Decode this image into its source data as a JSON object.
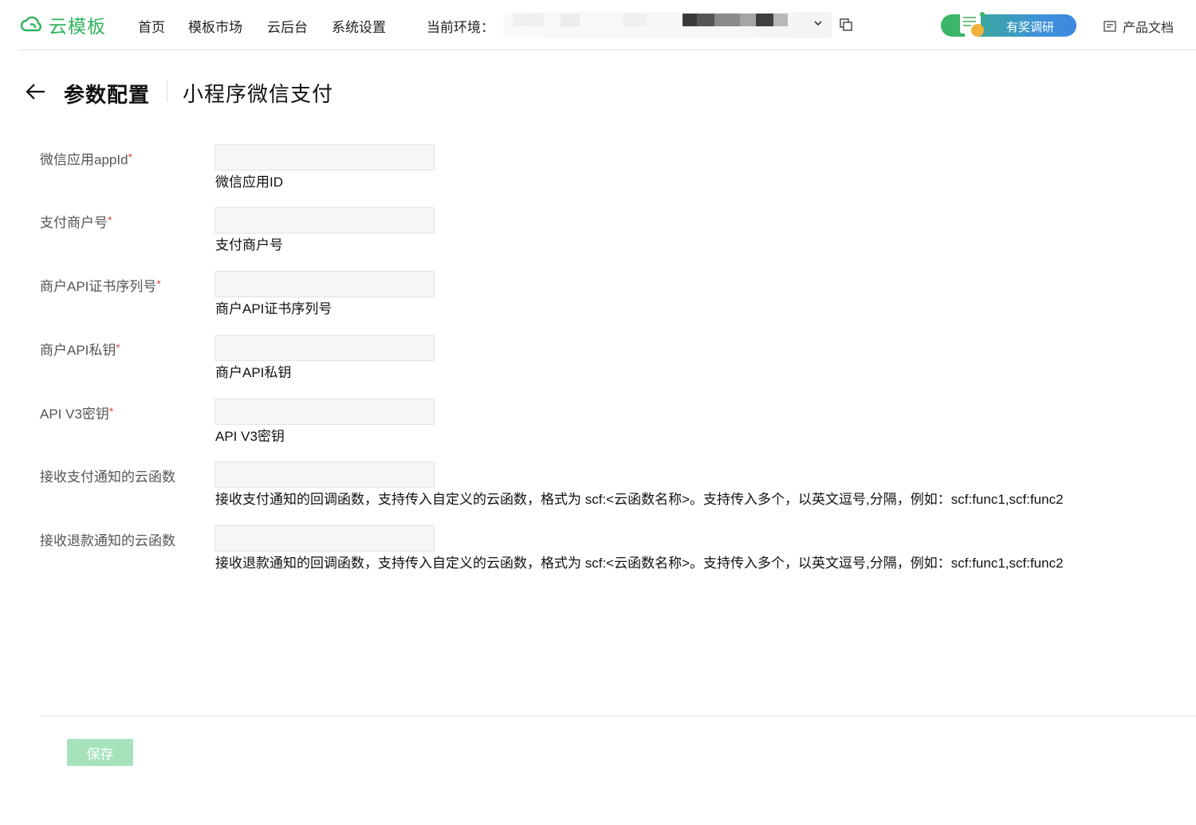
{
  "header": {
    "logo_text": "云模板",
    "nav": [
      {
        "label": "首页"
      },
      {
        "label": "模板市场"
      },
      {
        "label": "云后台"
      },
      {
        "label": "系统设置"
      }
    ],
    "env_label": "当前环境：",
    "survey_label": "有奖调研",
    "docs_label": "产品文档"
  },
  "page": {
    "title": "参数配置",
    "subtitle": "小程序微信支付"
  },
  "form": {
    "fields": [
      {
        "label": "微信应用appId",
        "required": "*",
        "value": "",
        "help": "微信应用ID"
      },
      {
        "label": "支付商户号",
        "required": "*",
        "value": "",
        "help": "支付商户号"
      },
      {
        "label": "商户API证书序列号",
        "required": "*",
        "value": "",
        "help": "商户API证书序列号"
      },
      {
        "label": "商户API私钥",
        "required": "*",
        "value": "",
        "help": "商户API私钥"
      },
      {
        "label": "API V3密钥",
        "required": "*",
        "value": "",
        "help": "API V3密钥"
      },
      {
        "label": "接收支付通知的云函数",
        "required": "",
        "value": "",
        "help": "接收支付通知的回调函数，支持传入自定义的云函数，格式为 scf:<云函数名称>。支持传入多个，以英文逗号,分隔，例如：scf:func1,scf:func2"
      },
      {
        "label": "接收退款通知的云函数",
        "required": "",
        "value": "",
        "help": "接收退款通知的回调函数，支持传入自定义的云函数，格式为 scf:<云函数名称>。支持传入多个，以英文逗号,分隔，例如：scf:func1,scf:func2"
      }
    ]
  },
  "footer": {
    "save_label": "保存"
  },
  "colors": {
    "brand_green": "#2fb45d",
    "save_disabled": "#a6e3bd",
    "required_red": "#e54545"
  }
}
